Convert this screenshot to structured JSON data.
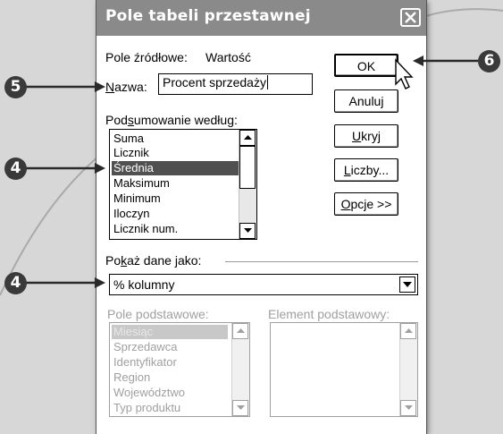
{
  "dialog": {
    "title": "Pole tabeli przestawnej",
    "source_field_label": "Pole źródłowe:",
    "source_field_value": "Wartość",
    "name_label_prefix": "N",
    "name_label_underlined": "a",
    "name_label_rest": "zwa:",
    "name_value": "Procent sprzedaży",
    "summarize_label_prefix": "Pod",
    "summarize_label_underlined": "s",
    "summarize_label_rest": "umowanie według:",
    "summarize_items": [
      "Suma",
      "Licznik",
      "Średnia",
      "Maksimum",
      "Minimum",
      "Iloczyn",
      "Licznik num."
    ],
    "summarize_selected": "Średnia",
    "show_data_label_prefix": "Po",
    "show_data_label_underlined": "k",
    "show_data_label_rest": "aż dane jako:",
    "show_data_value": "% kolumny",
    "base_field_label": "Pole podstawowe:",
    "base_item_label": "Element podstawowy:",
    "base_field_items": [
      "Miesiąc",
      "Sprzedawca",
      "Identyfikator",
      "Region",
      "Województwo",
      "Typ produktu"
    ],
    "base_field_selected": "Miesiąc"
  },
  "buttons": {
    "ok": "OK",
    "cancel": "Anuluj",
    "hide_underlined": "U",
    "hide_rest": "kryj",
    "numbers_underlined": "L",
    "numbers_rest": "iczby...",
    "options_underlined": "O",
    "options_rest": "pcje >>"
  },
  "callouts": {
    "step_name": "5",
    "step_ok": "6",
    "step_summarize": "4",
    "step_show_data": "4"
  },
  "icons": {
    "close": "close-icon",
    "scroll_up": "arrow-up-icon",
    "scroll_down": "arrow-down-icon",
    "dropdown": "chevron-down-icon",
    "cursor": "mouse-pointer-icon"
  },
  "colors": {
    "titlebar": "#8a8a8a",
    "selection": "#505050",
    "callout": "#3a3a3a",
    "disabled_text": "#a0a0a0"
  }
}
